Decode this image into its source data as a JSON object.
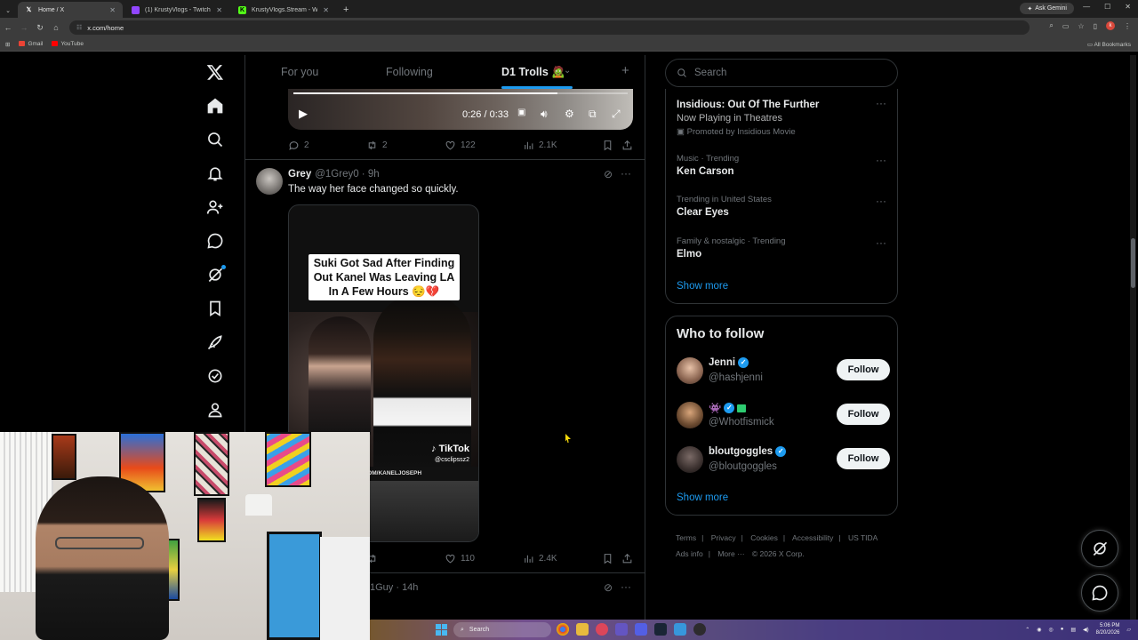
{
  "browser": {
    "tabs": [
      {
        "title": "Home / X",
        "favicon": "x-icon",
        "active": true
      },
      {
        "title": "(1) KrustyVlogs - Twitch",
        "favicon": "twitch-icon",
        "active": false
      },
      {
        "title": "KrustyVlogs.Stream - Watch Liv",
        "favicon": "kick-icon",
        "active": false
      }
    ],
    "new_tab": "+",
    "ask_gemini": "Ask Gemini",
    "url": "x.com/home",
    "profile_initial": "k",
    "bookmarks": [
      {
        "label": "Gmail",
        "color": "#ea4335"
      },
      {
        "label": "YouTube",
        "color": "#ff0000"
      }
    ],
    "all_bookmarks": "All Bookmarks"
  },
  "feed": {
    "tabs": {
      "for_you": "For you",
      "following": "Following",
      "custom": "D1 Trolls 🧟"
    },
    "add_tab": "+",
    "video": {
      "time": "0:26 / 0:33",
      "progress": 0.79
    },
    "first_post_actions": {
      "replies": "2",
      "reposts": "2",
      "likes": "122",
      "views": "2.1K"
    },
    "post": {
      "name": "Grey",
      "handle": "@1Grey0 · 9h",
      "text": "The way her face changed so quickly.",
      "media_caption": "Suki Got Sad After Finding Out Kanel Was Leaving LA In A Few Hours 😔💔",
      "tiktok": "TikTok",
      "tiktok_handle": "@csclipssz2",
      "kick_url": "KICK.COM/KANELJOSEPH",
      "actions": {
        "likes": "110",
        "views": "2.4K"
      }
    },
    "next_post_meta": "1Guy · 14h"
  },
  "sidebar": {
    "search_placeholder": "Search",
    "trends": [
      {
        "title": "Insidious: Out Of The Further",
        "sub": "Now Playing in Theatres",
        "promo": "Promoted by Insidious Movie"
      },
      {
        "meta": "Music · Trending",
        "title": "Ken Carson"
      },
      {
        "meta": "Trending in United States",
        "title": "Clear Eyes"
      },
      {
        "meta": "Family & nostalgic · Trending",
        "title": "Elmo"
      }
    ],
    "show_more": "Show more",
    "who_to_follow": {
      "heading": "Who to follow",
      "accounts": [
        {
          "name": "Jenni",
          "handle": "@hashjenni",
          "follow": "Follow",
          "verified": true
        },
        {
          "name": "👾",
          "handle": "@Whotfismick",
          "follow": "Follow",
          "verified": true
        },
        {
          "name": "bloutgoggles",
          "handle": "@bloutgoggles",
          "follow": "Follow",
          "verified": true
        }
      ],
      "show_more": "Show more"
    },
    "footer": {
      "links": [
        "Terms",
        "Privacy",
        "Cookies",
        "Accessibility",
        "US TIDA",
        "Ads info",
        "More ···"
      ],
      "copyright": "© 2026 X Corp."
    }
  },
  "taskbar": {
    "search": "Search",
    "time": "5:06 PM",
    "date": "8/20/2026"
  },
  "colors": {
    "accent": "#1d9bf0",
    "background": "#000000",
    "border": "#2f3336",
    "muted": "#71767b"
  }
}
